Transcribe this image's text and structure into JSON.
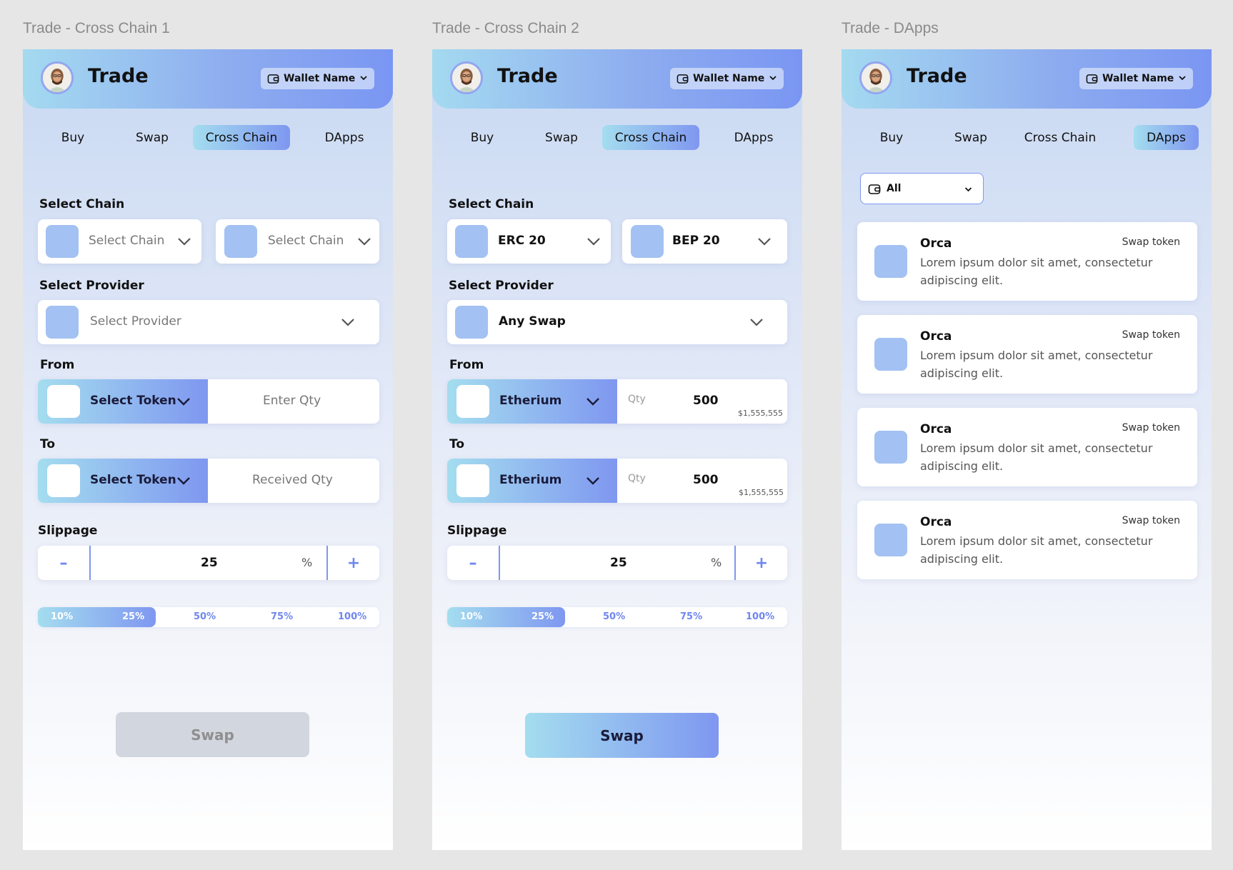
{
  "frames": [
    {
      "label": "Trade - Cross Chain 1",
      "header": {
        "title": "Trade",
        "wallet": "Wallet Name"
      },
      "tabs": [
        "Buy",
        "Swap",
        "Cross Chain",
        "DApps"
      ],
      "active_tab": "Cross Chain",
      "select_chain_label": "Select Chain",
      "chain_from": "Select Chain",
      "chain_to": "Select Chain",
      "select_provider_label": "Select Provider",
      "provider": "Select Provider",
      "from_label": "From",
      "from_token": "Select Token",
      "from_qty_placeholder": "Enter Qty",
      "to_label": "To",
      "to_token": "Select Token",
      "to_qty_placeholder": "Received Qty",
      "slippage_label": "Slippage",
      "slippage_value": "25",
      "slippage_unit": "%",
      "slippage_minus": "–",
      "slippage_plus": "+",
      "presets": [
        "10%",
        "25%",
        "50%",
        "75%",
        "100%"
      ],
      "preset_fill_fraction": 0.25,
      "swap_label": "Swap",
      "swap_enabled": false
    },
    {
      "label": "Trade - Cross Chain 2",
      "header": {
        "title": "Trade",
        "wallet": "Wallet Name"
      },
      "tabs": [
        "Buy",
        "Swap",
        "Cross Chain",
        "DApps"
      ],
      "active_tab": "Cross Chain",
      "select_chain_label": "Select Chain",
      "chain_from": "ERC 20",
      "chain_to": "BEP 20",
      "select_provider_label": "Select Provider",
      "provider": "Any Swap",
      "from_label": "From",
      "from_token": "Etherium",
      "from_qty_label": "Qty",
      "from_qty": "500",
      "from_usd": "$1,555,555",
      "to_label": "To",
      "to_token": "Etherium",
      "to_qty_label": "Qty",
      "to_qty": "500",
      "to_usd": "$1,555,555",
      "slippage_label": "Slippage",
      "slippage_value": "25",
      "slippage_unit": "%",
      "slippage_minus": "–",
      "slippage_plus": "+",
      "presets": [
        "10%",
        "25%",
        "50%",
        "75%",
        "100%"
      ],
      "preset_fill_fraction": 0.25,
      "swap_label": "Swap",
      "swap_enabled": true
    },
    {
      "label": "Trade - DApps",
      "header": {
        "title": "Trade",
        "wallet": "Wallet Name"
      },
      "tabs": [
        "Buy",
        "Swap",
        "Cross Chain",
        "DApps"
      ],
      "active_tab": "DApps",
      "filter": "All",
      "dapps": [
        {
          "name": "Orca",
          "tag": "Swap token",
          "desc": "Lorem ipsum dolor sit amet, consectetur adipiscing elit."
        },
        {
          "name": "Orca",
          "tag": "Swap token",
          "desc": "Lorem ipsum dolor sit amet, consectetur adipiscing elit."
        },
        {
          "name": "Orca",
          "tag": "Swap token",
          "desc": "Lorem ipsum dolor sit amet, consectetur adipiscing elit."
        },
        {
          "name": "Orca",
          "tag": "Swap token",
          "desc": "Lorem ipsum dolor sit amet, consectetur adipiscing elit."
        }
      ]
    }
  ],
  "colors": {
    "accent": "#7f97f0",
    "accent_light": "#a4ddef",
    "token_square": "#a3c1f2",
    "disabled": "#d2d6de"
  },
  "icons": {
    "avatar": "user-avatar",
    "wallet": "wallet-icon",
    "chevron": "chevron-down-icon"
  }
}
